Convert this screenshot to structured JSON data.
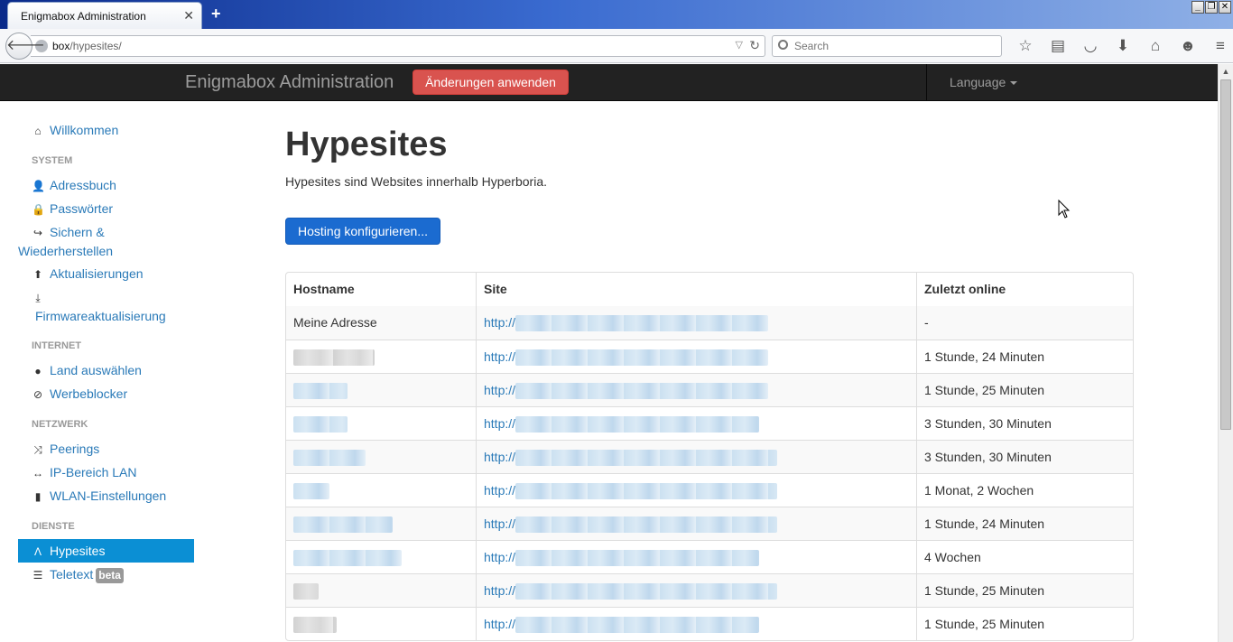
{
  "browser": {
    "tab_title": "Enigmabox Administration",
    "tab_close": "✕",
    "new_tab": "+",
    "url_host": "box",
    "url_path": "/hypesites/",
    "search_placeholder": "Search",
    "window_controls": [
      "_",
      "❐",
      "✕"
    ],
    "toolbar_icons": [
      "star-icon",
      "reader-icon",
      "pocket-icon",
      "download-icon",
      "home-icon",
      "chat-icon",
      "menu-icon"
    ]
  },
  "app": {
    "brand": "Enigmabox Administration",
    "apply_button": "Änderungen anwenden",
    "language": "Language",
    "colors": {
      "navbar": "#222222",
      "danger": "#d9534f",
      "primary": "#1b6bd0",
      "link": "#2a7ab8",
      "active": "#0b8fd4"
    }
  },
  "sidebar": {
    "welcome": "Willkommen",
    "system_heading": "SYSTEM",
    "addressbook": "Adressbuch",
    "passwords": "Passwörter",
    "backup_1": "Sichern &",
    "backup_2": "Wiederherstellen",
    "updates": "Aktualisierungen",
    "firmware": "Firmwareaktualisierung",
    "internet_heading": "INTERNET",
    "country": "Land auswählen",
    "adblock": "Werbeblocker",
    "network_heading": "NETZWERK",
    "peerings": "Peerings",
    "lan_range": "IP-Bereich LAN",
    "wlan": "WLAN-Einstellungen",
    "services_heading": "DIENSTE",
    "hypesites": "Hypesites",
    "teletext": "Teletext",
    "beta": "beta"
  },
  "main": {
    "title": "Hypesites",
    "lead": "Hypesites sind Websites innerhalb Hyperboria.",
    "hosting_button": "Hosting konfigurieren...",
    "table": {
      "headers": [
        "Hostname",
        "Site",
        "Zuletzt online"
      ],
      "link_prefix": "http://",
      "rows": [
        {
          "hostname": "Meine Adresse",
          "last_online": "-"
        },
        {
          "hostname": "",
          "last_online": "1 Stunde, 24 Minuten"
        },
        {
          "hostname": "",
          "last_online": "1 Stunde, 25 Minuten"
        },
        {
          "hostname": "",
          "last_online": "3 Stunden, 30 Minuten"
        },
        {
          "hostname": "",
          "last_online": "3 Stunden, 30 Minuten"
        },
        {
          "hostname": "",
          "last_online": "1 Monat, 2 Wochen"
        },
        {
          "hostname": "",
          "last_online": "1 Stunde, 24 Minuten"
        },
        {
          "hostname": "",
          "last_online": "4 Wochen"
        },
        {
          "hostname": "",
          "last_online": "1 Stunde, 25 Minuten"
        },
        {
          "hostname": "",
          "last_online": "1 Stunde, 25 Minuten"
        }
      ]
    }
  }
}
